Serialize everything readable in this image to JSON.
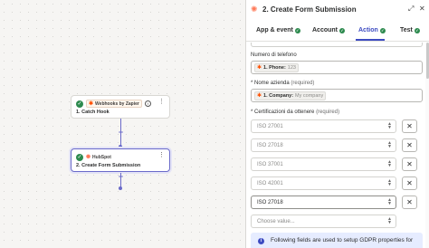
{
  "canvas": {
    "step1": {
      "app_name": "Webhooks by Zapier",
      "title": "1. Catch Hook",
      "status": "complete"
    },
    "step2": {
      "app_name": "HubSpot",
      "title": "2. Create Form Submission",
      "status": "complete"
    },
    "add_step_symbol": "+",
    "menu_symbol": "⋮"
  },
  "panel": {
    "title": "2. Create Form Submission",
    "expand_symbol": "⤢",
    "close_symbol": "✕",
    "tabs": [
      {
        "label": "App & event",
        "complete": true
      },
      {
        "label": "Account",
        "complete": true
      },
      {
        "label": "Action",
        "complete": true
      },
      {
        "label": "Test",
        "complete": true
      }
    ],
    "active_tab": "Action",
    "fields": {
      "phone": {
        "label": "Numero di telefono",
        "pill_step": "1. Phone:",
        "pill_value": "123"
      },
      "company": {
        "label": "Nome azienda",
        "required_text": "(required)",
        "asterisk": "*",
        "pill_step": "1. Company:",
        "pill_value": "My company"
      },
      "certifications": {
        "label": "Certificazioni da ottenere",
        "required_text": "(required)",
        "asterisk": "*",
        "values": [
          "ISO 27001",
          "ISO 27018",
          "ISO 37001",
          "ISO 42001",
          "ISO 27018"
        ],
        "placeholder": "Choose value...",
        "remove_symbol": "✕"
      }
    },
    "info_text": "Following fields are used to setup GDPR properties for"
  },
  "colors": {
    "accent": "#3d4bc1",
    "connector": "#6a6ac9",
    "success": "#2d8a4e",
    "hubspot": "#ff7a59",
    "zapier": "#ff4f00"
  }
}
